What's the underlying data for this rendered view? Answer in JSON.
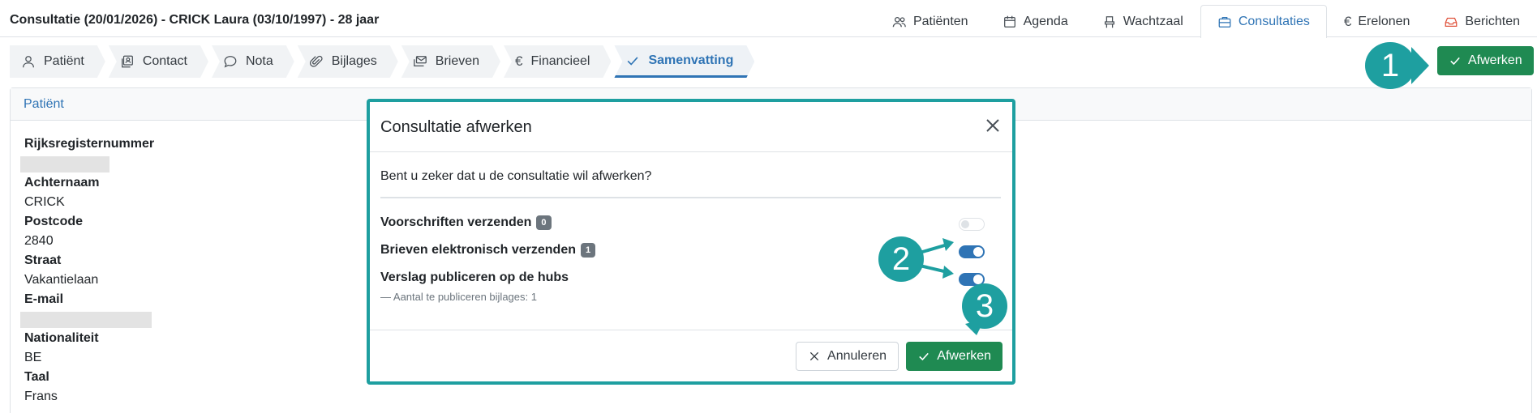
{
  "header": {
    "title": "Consultatie (20/01/2026) - CRICK Laura (03/10/1997) - 28 jaar",
    "nav": [
      {
        "label": "Patiënten",
        "icon": "users-icon"
      },
      {
        "label": "Agenda",
        "icon": "calendar-icon"
      },
      {
        "label": "Wachtzaal",
        "icon": "chair-icon"
      },
      {
        "label": "Consultaties",
        "icon": "briefcase-icon",
        "active": true
      },
      {
        "label": "Erelonen",
        "icon": "euro-icon"
      },
      {
        "label": "Berichten",
        "icon": "inbox-icon"
      }
    ]
  },
  "tabs": [
    {
      "label": "Patiënt",
      "icon": "person-icon"
    },
    {
      "label": "Contact",
      "icon": "contact-icon"
    },
    {
      "label": "Nota",
      "icon": "chat-icon"
    },
    {
      "label": "Bijlages",
      "icon": "paperclip-icon"
    },
    {
      "label": "Brieven",
      "icon": "envelopes-icon"
    },
    {
      "label": "Financieel",
      "icon": "euro-icon"
    },
    {
      "label": "Samenvatting",
      "icon": "check-icon",
      "active": true
    }
  ],
  "toolbar": {
    "afwerken_label": "Afwerken"
  },
  "callouts": {
    "one": "1",
    "two": "2",
    "three": "3"
  },
  "patient_card": {
    "header": "Patiënt",
    "fields": {
      "rijksregister_label": "Rijksregisternummer",
      "achternaam_label": "Achternaam",
      "achternaam_value": "CRICK",
      "postcode_label": "Postcode",
      "postcode_value": "2840",
      "straat_label": "Straat",
      "straat_value": "Vakantielaan",
      "email_label": "E-mail",
      "nationaliteit_label": "Nationaliteit",
      "nationaliteit_value": "BE",
      "taal_label": "Taal",
      "taal_value": "Frans"
    }
  },
  "modal": {
    "title": "Consultatie afwerken",
    "question": "Bent u zeker dat u de consultatie wil afwerken?",
    "options": [
      {
        "label": "Voorschriften verzenden",
        "count": "0",
        "enabled": false
      },
      {
        "label": "Brieven elektronisch verzenden",
        "count": "1",
        "enabled": true
      },
      {
        "label": "Verslag publiceren op de hubs",
        "enabled": true
      }
    ],
    "note": "—  Aantal te publiceren bijlages: 1",
    "cancel_label": "Annuleren",
    "confirm_label": "Afwerken"
  },
  "colors": {
    "accent": "#2f74b5",
    "green": "#1f8a52",
    "teal": "#1e9fa0"
  }
}
